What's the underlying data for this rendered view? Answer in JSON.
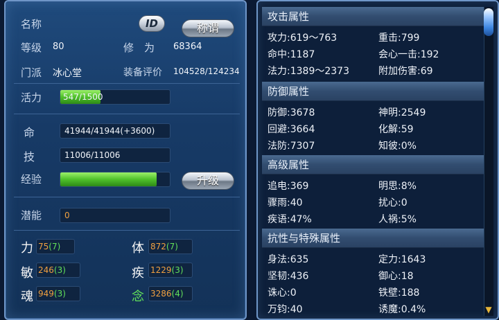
{
  "left": {
    "name_label": "名称",
    "name_value": "",
    "id_icon_text": "ID",
    "title_button": "称谓",
    "level_label": "等级",
    "level_value": "80",
    "cultivation_label": "修　为",
    "cultivation_value": "68364",
    "sect_label": "门派",
    "sect_value": "冰心堂",
    "gear_label": "装备评价",
    "gear_value": "104528/124234",
    "vitality_label": "活力",
    "vitality_value": "547/1500",
    "vitality_fraction": 0.365,
    "hp_label": "命",
    "hp_value": "41944/41944(+3600)",
    "skill_label": "技",
    "skill_value": "11006/11006",
    "exp_label": "经验",
    "exp_fraction": 0.88,
    "upgrade_button": "升级",
    "potential_label": "潜能",
    "potential_value": "0",
    "attrs": [
      {
        "name": "力",
        "value": "75",
        "bonus": "(7)"
      },
      {
        "name": "体",
        "value": "872",
        "bonus": "(7)"
      },
      {
        "name": "敏",
        "value": "246",
        "bonus": "(3)"
      },
      {
        "name": "疾",
        "value": "1229",
        "bonus": "(3)"
      },
      {
        "name": "魂",
        "value": "949",
        "bonus": "(3)"
      },
      {
        "name": "念",
        "value": "3286",
        "bonus": "(4)"
      }
    ]
  },
  "right": {
    "sections": [
      {
        "title": "攻击属性",
        "stats": [
          {
            "label": "攻力:",
            "value": "619～763"
          },
          {
            "label": "重击:",
            "value": "799"
          },
          {
            "label": "命中:",
            "value": "1187"
          },
          {
            "label": "会心一击:",
            "value": "192"
          },
          {
            "label": "法力:",
            "value": "1389～2373"
          },
          {
            "label": "附加伤害:",
            "value": "69"
          }
        ]
      },
      {
        "title": "防御属性",
        "stats": [
          {
            "label": "防御:",
            "value": "3678"
          },
          {
            "label": "神明:",
            "value": "2549"
          },
          {
            "label": "回避:",
            "value": "3664"
          },
          {
            "label": "化解:",
            "value": "59"
          },
          {
            "label": "法防:",
            "value": "7307"
          },
          {
            "label": "知彼:",
            "value": "0%"
          }
        ]
      },
      {
        "title": "高级属性",
        "stats": [
          {
            "label": "追电:",
            "value": "369"
          },
          {
            "label": "明思:",
            "value": "8%"
          },
          {
            "label": "骤雨:",
            "value": "40"
          },
          {
            "label": "扰心:",
            "value": "0"
          },
          {
            "label": "疾语:",
            "value": "47%"
          },
          {
            "label": "人祸:",
            "value": "5%"
          }
        ]
      },
      {
        "title": "抗性与特殊属性",
        "stats": [
          {
            "label": "身法:",
            "value": "635"
          },
          {
            "label": "定力:",
            "value": "1643"
          },
          {
            "label": "坚韧:",
            "value": "436"
          },
          {
            "label": "御心:",
            "value": "18"
          },
          {
            "label": "诛心:",
            "value": "0"
          },
          {
            "label": "铁壁:",
            "value": "188"
          },
          {
            "label": "万钧:",
            "value": "40"
          },
          {
            "label": "诱魔:",
            "value": "0.4%"
          }
        ]
      }
    ]
  },
  "colors": {
    "exp_bar": "#4fc12a",
    "attr_value": "#f0a040",
    "bonus": "#62e05a"
  }
}
